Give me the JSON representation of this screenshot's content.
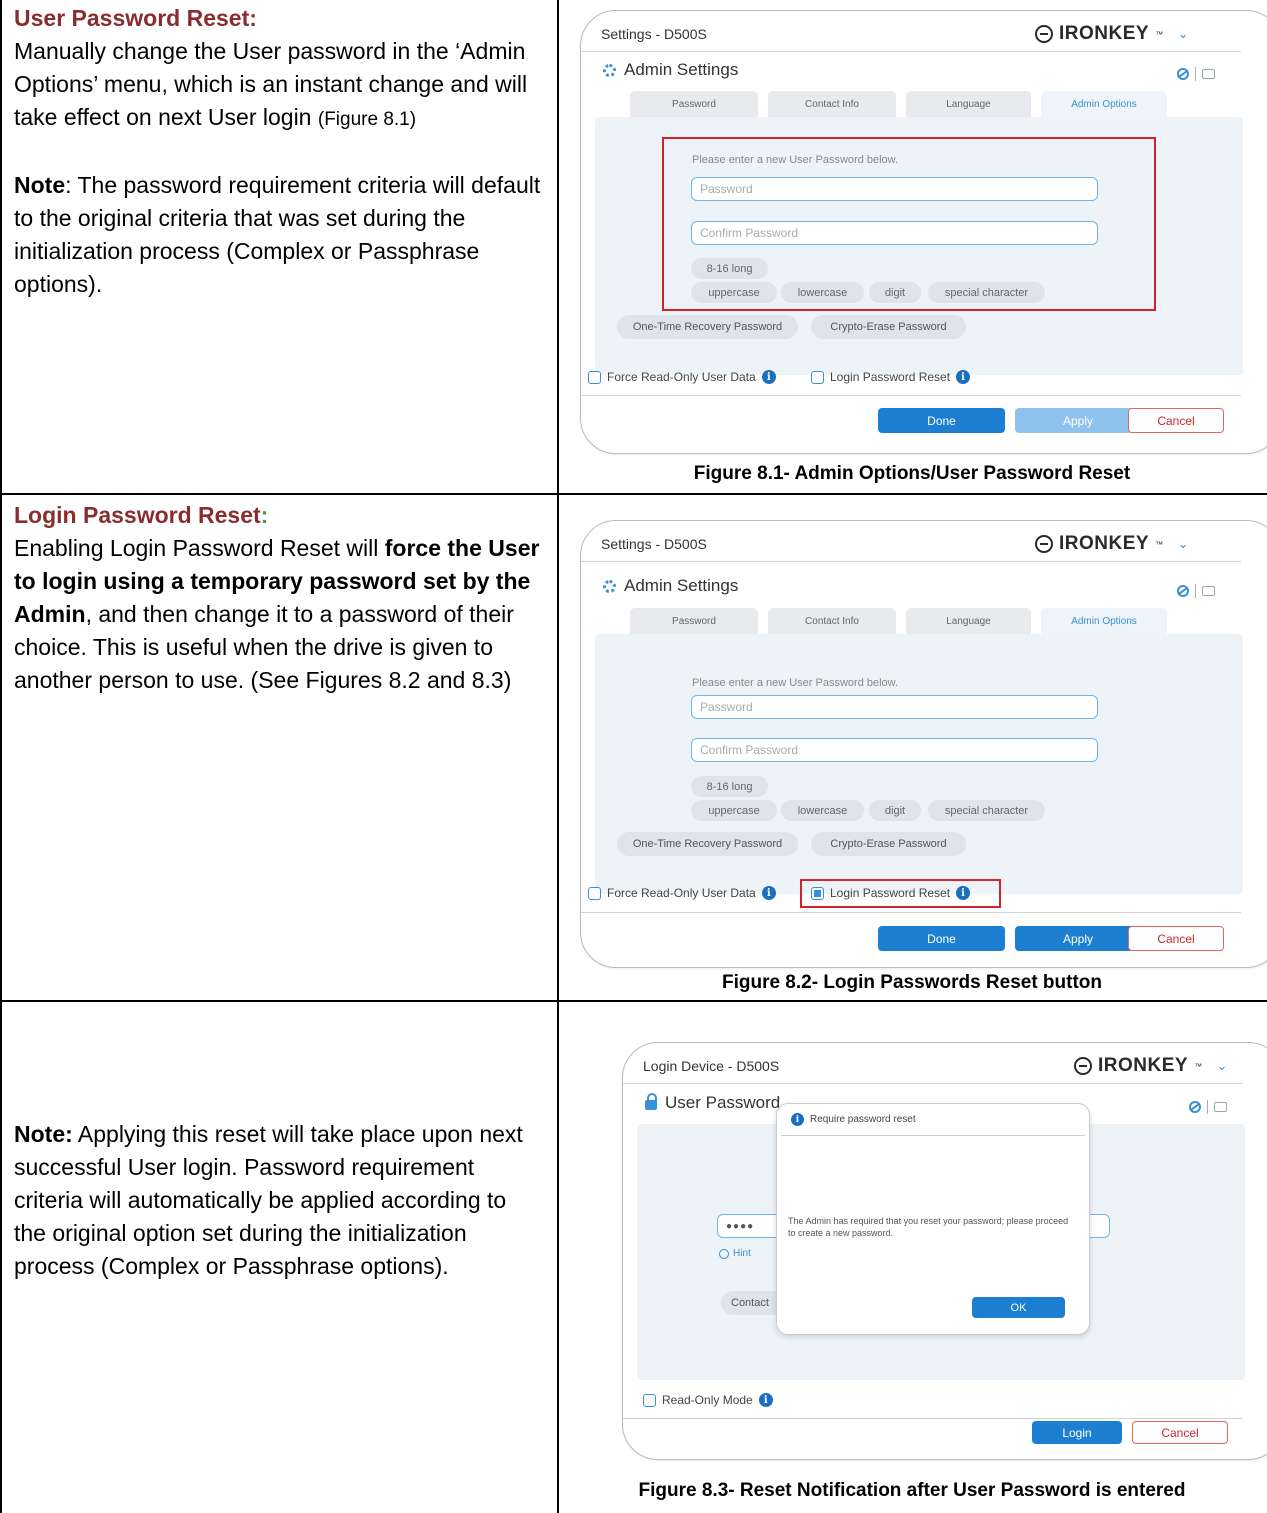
{
  "row1": {
    "heading": "User Password Reset:",
    "body": "Manually change the User password in the ‘Admin Options’ menu, which is an instant change and will take effect on next User login ",
    "fig_ref": "(Figure 8.1)",
    "note_label": "Note",
    "note_text": ": The password requirement criteria will default to the original criteria that was set during the initialization process (Complex or Passphrase options).",
    "caption": "Figure 8.1- Admin Options/User Password Reset"
  },
  "row2": {
    "heading": "Login Password Reset",
    "heading_colon": ":",
    "body_1": "Enabling Login Password Reset will ",
    "body_bold": "force the User to login using a temporary password set by the Admin",
    "body_2": ", and then change it to a password of their choice. This is useful when the drive is given to another person to use. (See Figures 8.2 and 8.3)",
    "caption": "Figure 8.2- Login Passwords Reset button"
  },
  "row3": {
    "note_label": "Note:",
    "note_text": "  Applying this reset will take place upon next successful User login. Password requirement criteria will automatically be applied according to the original option set during the initialization process (Complex or Passphrase options).",
    "caption": "Figure 8.3- Reset Notification after User Password is entered"
  },
  "settings_window": {
    "title": "Settings - D500S",
    "brand": "IRONKEY",
    "brand_tm": "™",
    "section": "Admin Settings",
    "tabs": [
      "Password",
      "Contact Info",
      "Language",
      "Admin Options"
    ],
    "prompt": "Please enter a new User Password below.",
    "password_placeholder": "Password",
    "confirm_placeholder": "Confirm Password",
    "length_chip": "8-16 long",
    "criteria": [
      "uppercase",
      "lowercase",
      "digit",
      "special character"
    ],
    "extra_buttons": [
      "One-Time Recovery Password",
      "Crypto-Erase Password"
    ],
    "checkbox_readonly": "Force Read-Only User Data",
    "checkbox_login_reset": "Login Password Reset",
    "btn_done": "Done",
    "btn_apply": "Apply",
    "btn_cancel": "Cancel"
  },
  "login_window": {
    "title": "Login Device - D500S",
    "brand": "IRONKEY",
    "brand_tm": "™",
    "section": "User Password",
    "password_dots": "●●●●",
    "hint": "Hint",
    "contact_partial": "Contact",
    "readonly": "Read-Only Mode",
    "btn_login": "Login",
    "btn_cancel": "Cancel",
    "modal": {
      "title": "Require password reset",
      "message": "The Admin has required that you reset your password; please proceed to create a new password.",
      "ok": "OK"
    }
  },
  "colors": {
    "heading": "#8a2d2d",
    "accent_blue": "#1c7fd1",
    "highlight_red": "#d2232a"
  }
}
